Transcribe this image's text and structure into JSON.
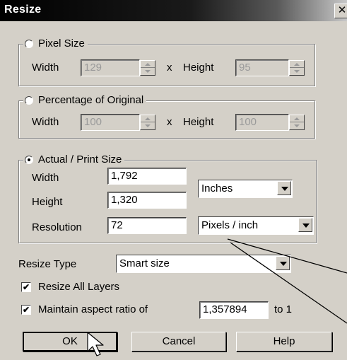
{
  "window": {
    "title": "Resize",
    "close_glyph": "✕"
  },
  "pixel_size": {
    "legend": "Pixel Size",
    "width_label": "Width",
    "width_value": "129",
    "x_label": "x",
    "height_label": "Height",
    "height_value": "95"
  },
  "percentage": {
    "legend": "Percentage of Original",
    "width_label": "Width",
    "width_value": "100",
    "x_label": "x",
    "height_label": "Height",
    "height_value": "100"
  },
  "actual_print": {
    "legend": "Actual / Print Size",
    "width_label": "Width",
    "width_value": "1,792",
    "height_label": "Height",
    "height_value": "1,320",
    "units_value": "Inches",
    "resolution_label": "Resolution",
    "resolution_value": "72",
    "resolution_units_value": "Pixels / inch"
  },
  "resize_type": {
    "label": "Resize Type",
    "value": "Smart size"
  },
  "resize_all_layers": {
    "label": "Resize All Layers",
    "checked": true
  },
  "maintain_aspect": {
    "label": "Maintain aspect ratio of",
    "value": "1,357894",
    "suffix": "to 1",
    "checked": true
  },
  "buttons": {
    "ok": "OK",
    "cancel": "Cancel",
    "help": "Help"
  }
}
